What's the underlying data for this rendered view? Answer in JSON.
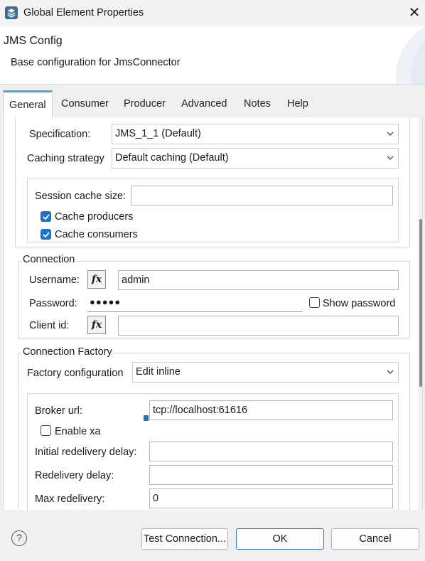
{
  "window": {
    "title": "Global Element Properties",
    "close_glyph": "✕"
  },
  "header": {
    "title": "JMS Config",
    "subtitle": "Base configuration for JmsConnector"
  },
  "tabs": [
    {
      "label": "General"
    },
    {
      "label": "Consumer"
    },
    {
      "label": "Producer"
    },
    {
      "label": "Advanced"
    },
    {
      "label": "Notes"
    },
    {
      "label": "Help"
    }
  ],
  "general": {
    "specification": {
      "label": "Specification:",
      "value": "JMS_1_1 (Default)"
    },
    "caching_strategy": {
      "label": "Caching strategy",
      "value": "Default caching (Default)"
    },
    "caching": {
      "session_cache_size": {
        "label": "Session cache size:",
        "value": ""
      },
      "cache_producers": {
        "label": "Cache producers",
        "checked": true
      },
      "cache_consumers": {
        "label": "Cache consumers",
        "checked": true
      }
    }
  },
  "connection": {
    "title": "Connection",
    "username": {
      "label": "Username:",
      "value": "admin"
    },
    "password": {
      "label": "Password:",
      "value": "●●●●●"
    },
    "show_password": {
      "label": "Show password",
      "checked": false
    },
    "client_id": {
      "label": "Client id:",
      "value": ""
    },
    "fx_label": "fx"
  },
  "connection_factory": {
    "title": "Connection Factory",
    "factory_configuration": {
      "label": "Factory configuration",
      "value": "Edit inline"
    },
    "broker_url": {
      "label": "Broker url:",
      "value": "tcp://localhost:61616"
    },
    "enable_xa": {
      "label": "Enable xa",
      "checked": false
    },
    "initial_redelivery_delay": {
      "label": "Initial redelivery delay:",
      "value": ""
    },
    "redelivery_delay": {
      "label": "Redelivery delay:",
      "value": ""
    },
    "max_redelivery": {
      "label": "Max redelivery:",
      "value": "0"
    }
  },
  "footer": {
    "help_glyph": "?",
    "test_connection": "Test Connection...",
    "ok": "OK",
    "cancel": "Cancel"
  },
  "colors": {
    "accent": "#1a73c8",
    "tab_indicator": "#4aa3df",
    "primary_border": "#2a72d4"
  },
  "icons": [
    "app-icon",
    "close-icon",
    "chevron-down-icon",
    "fx-icon",
    "info-icon",
    "help-icon",
    "checkmark-icon"
  ]
}
